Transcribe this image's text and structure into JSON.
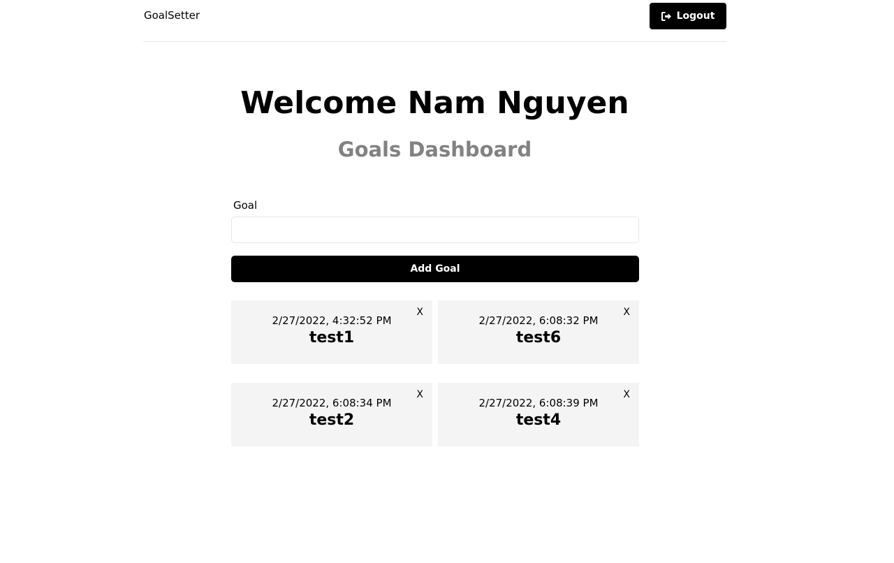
{
  "header": {
    "logo": "GoalSetter",
    "logout_label": "Logout"
  },
  "welcome": "Welcome Nam Nguyen",
  "dashboard_title": "Goals Dashboard",
  "form": {
    "label": "Goal",
    "value": "",
    "submit_label": "Add Goal"
  },
  "goals": [
    {
      "date": "2/27/2022, 4:32:52 PM",
      "text": "test1",
      "close": "X"
    },
    {
      "date": "2/27/2022, 6:08:32 PM",
      "text": "test6",
      "close": "X"
    },
    {
      "date": "2/27/2022, 6:08:34 PM",
      "text": "test2",
      "close": "X"
    },
    {
      "date": "2/27/2022, 6:08:39 PM",
      "text": "test4",
      "close": "X"
    }
  ],
  "icons": {
    "logout": "sign-out-icon"
  },
  "colors": {
    "primary": "#000000",
    "subtitle": "#828282",
    "card_bg": "#f4f4f4",
    "divider": "#e6e6e6"
  }
}
